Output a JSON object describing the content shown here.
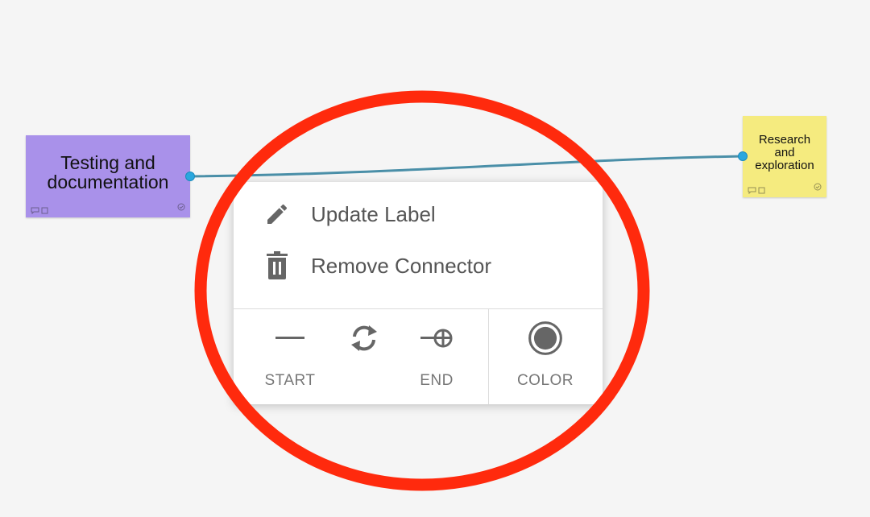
{
  "board": {
    "sticky_left": {
      "text": "Testing and documentation",
      "color": "#a991ea"
    },
    "sticky_right": {
      "text": "Research and exploration",
      "color": "#f5eb7f"
    },
    "connector_color": "#4a8fa8",
    "handle_color": "#2aa7de"
  },
  "context_menu": {
    "items": [
      {
        "label": "Update Label",
        "icon": "pencil-icon"
      },
      {
        "label": "Remove Connector",
        "icon": "trash-icon"
      }
    ],
    "tools": {
      "start_label": "START",
      "swap_label": "",
      "end_label": "END",
      "color_label": "COLOR"
    },
    "current_color": "#666666"
  },
  "annotation": {
    "shape": "ellipse",
    "color": "#ff2a0d"
  }
}
